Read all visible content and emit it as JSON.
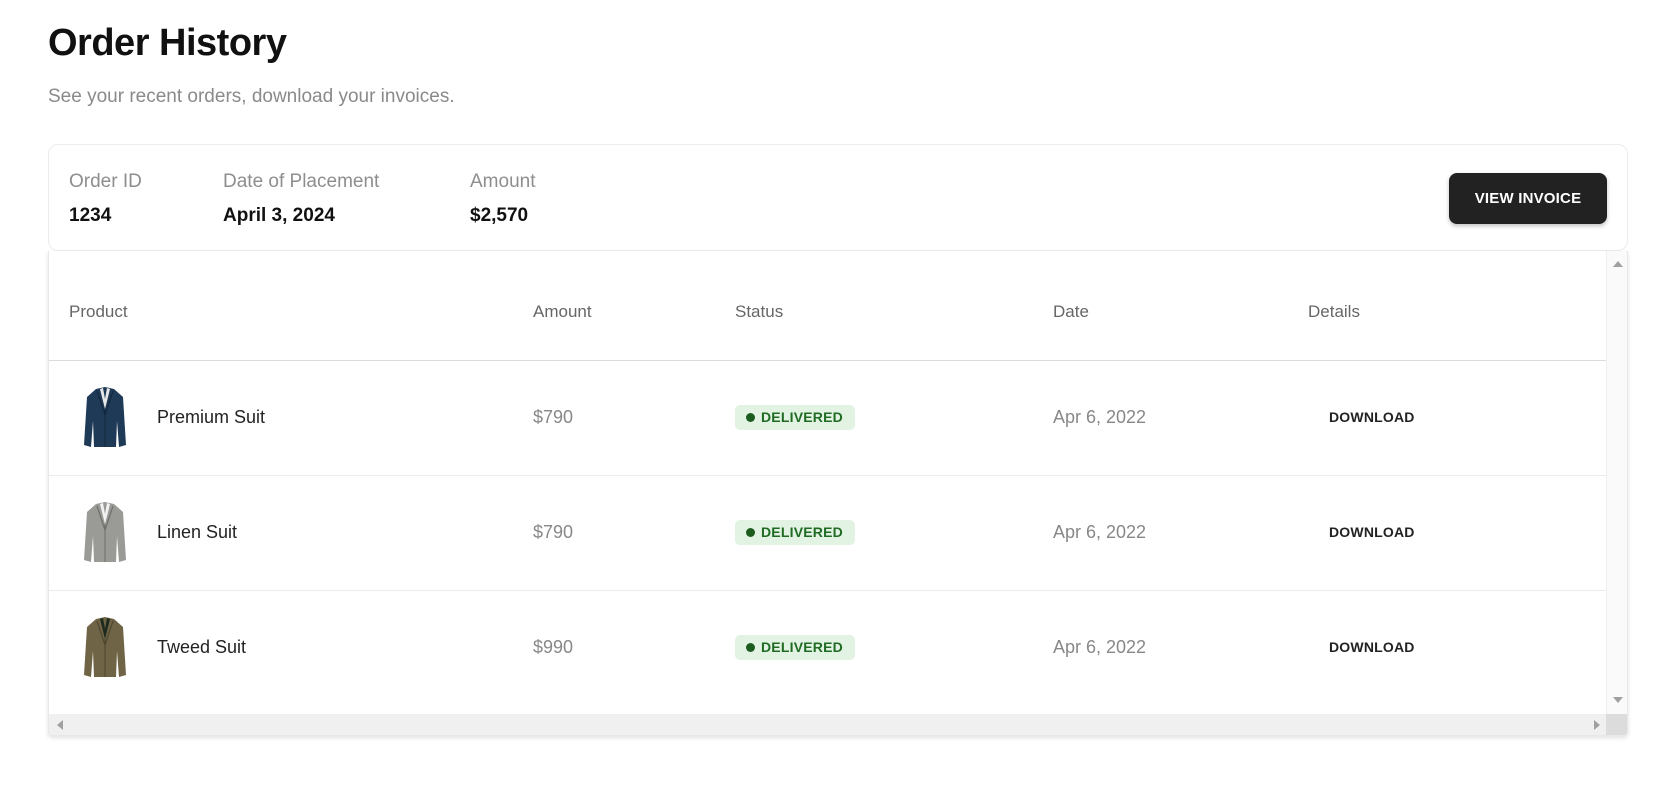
{
  "header": {
    "title": "Order History",
    "subtitle": "See your recent orders, download your invoices."
  },
  "summary": {
    "order_id_label": "Order ID",
    "order_id": "1234",
    "date_label": "Date of Placement",
    "date": "April 3, 2024",
    "amount_label": "Amount",
    "amount": "$2,570",
    "view_invoice_label": "VIEW INVOICE"
  },
  "table": {
    "columns": [
      "Product",
      "Amount",
      "Status",
      "Date",
      "Details"
    ],
    "rows": [
      {
        "product": "Premium Suit",
        "amount": "$790",
        "status": "DELIVERED",
        "date": "Apr 6, 2022",
        "action": "DOWNLOAD",
        "image": "navy-suit-jacket",
        "color": "#1f3a57"
      },
      {
        "product": "Linen Suit",
        "amount": "$790",
        "status": "DELIVERED",
        "date": "Apr 6, 2022",
        "action": "DOWNLOAD",
        "image": "grey-suit-jacket",
        "color": "#9a9a96"
      },
      {
        "product": "Tweed Suit",
        "amount": "$990",
        "status": "DELIVERED",
        "date": "Apr 6, 2022",
        "action": "DOWNLOAD",
        "image": "olive-tweed-jacket",
        "color": "#6f6446"
      }
    ]
  },
  "colors": {
    "button_bg": "#222222",
    "badge_bg": "#e3f3e3",
    "badge_text": "#1f6b23"
  }
}
